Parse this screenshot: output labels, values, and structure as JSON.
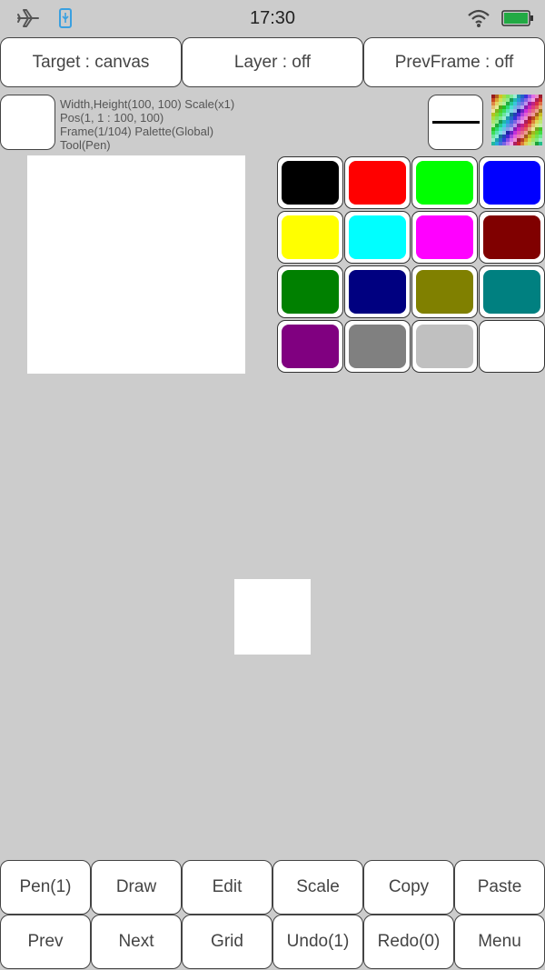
{
  "status_bar": {
    "time": "17:30",
    "left_icons": [
      "airplane-icon",
      "usb-icon"
    ],
    "right_icons": [
      "wifi-icon",
      "battery-icon"
    ],
    "battery_color": "#22aa44"
  },
  "top_bar": {
    "target_label": "Target : canvas",
    "layer_label": "Layer : off",
    "prevframe_label": "PrevFrame : off"
  },
  "info": {
    "line1": "Width,Height(100, 100)  Scale(x1)",
    "line2": "Pos(1, 1 : 100, 100)",
    "line3": "Frame(1/104)  Palette(Global)",
    "line4": "Tool(Pen)"
  },
  "palette": {
    "colors": [
      "#000000",
      "#ff0000",
      "#00ff00",
      "#0000ff",
      "#ffff00",
      "#00ffff",
      "#ff00ff",
      "#800000",
      "#008000",
      "#000080",
      "#808000",
      "#008080",
      "#800080",
      "#808080",
      "#c0c0c0",
      "#ffffff"
    ]
  },
  "bottom_bar": {
    "row1": [
      "Pen(1)",
      "Draw",
      "Edit",
      "Scale",
      "Copy",
      "Paste"
    ],
    "row2": [
      "Prev",
      "Next",
      "Grid",
      "Undo(1)",
      "Redo(0)",
      "Menu"
    ]
  }
}
